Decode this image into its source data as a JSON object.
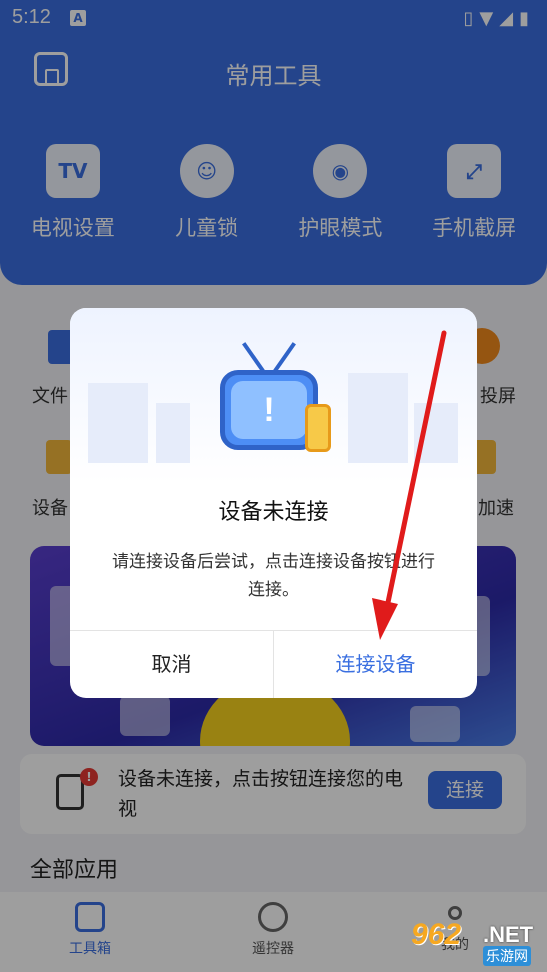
{
  "status_bar": {
    "time": "5:12",
    "notification_badge": "A",
    "icons": [
      "vibrate-icon",
      "wifi-icon",
      "signal-icon",
      "battery-icon"
    ]
  },
  "header": {
    "title": "常用工具"
  },
  "tools": [
    {
      "label": "电视设置",
      "icon": "tv-icon",
      "glyph": "TV"
    },
    {
      "label": "儿童锁",
      "icon": "child-face-icon",
      "glyph": "☺"
    },
    {
      "label": "护眼模式",
      "icon": "eye-icon",
      "glyph": "◉"
    },
    {
      "label": "手机截屏",
      "icon": "screenshot-icon",
      "glyph": "⤢"
    }
  ],
  "background_grid": {
    "file_label_partial": "文件",
    "cast_label_partial": "投屏",
    "device_label_partial": "设备",
    "speed_label_partial": "加速"
  },
  "connect_card": {
    "alert_badge": "!",
    "message": "设备未连接，点击按钮连接您的电视",
    "button": "连接"
  },
  "section": {
    "all_apps": "全部应用"
  },
  "bottom_nav": [
    {
      "label": "工具箱",
      "active": true
    },
    {
      "label": "遥控器",
      "active": false
    },
    {
      "label": "我的",
      "active": false
    }
  ],
  "dialog": {
    "title": "设备未连接",
    "message": "请连接设备后尝试，点击连接设备按钮进行连接。",
    "cancel": "取消",
    "confirm": "连接设备",
    "tv_glyph": "!"
  },
  "watermark": {
    "number": "962",
    "domain": ".NET",
    "sub": "乐游网"
  },
  "colors": {
    "brand_blue": "#3a6fe0",
    "annotation_red": "#e01b1b",
    "alert_red": "#e53935"
  }
}
